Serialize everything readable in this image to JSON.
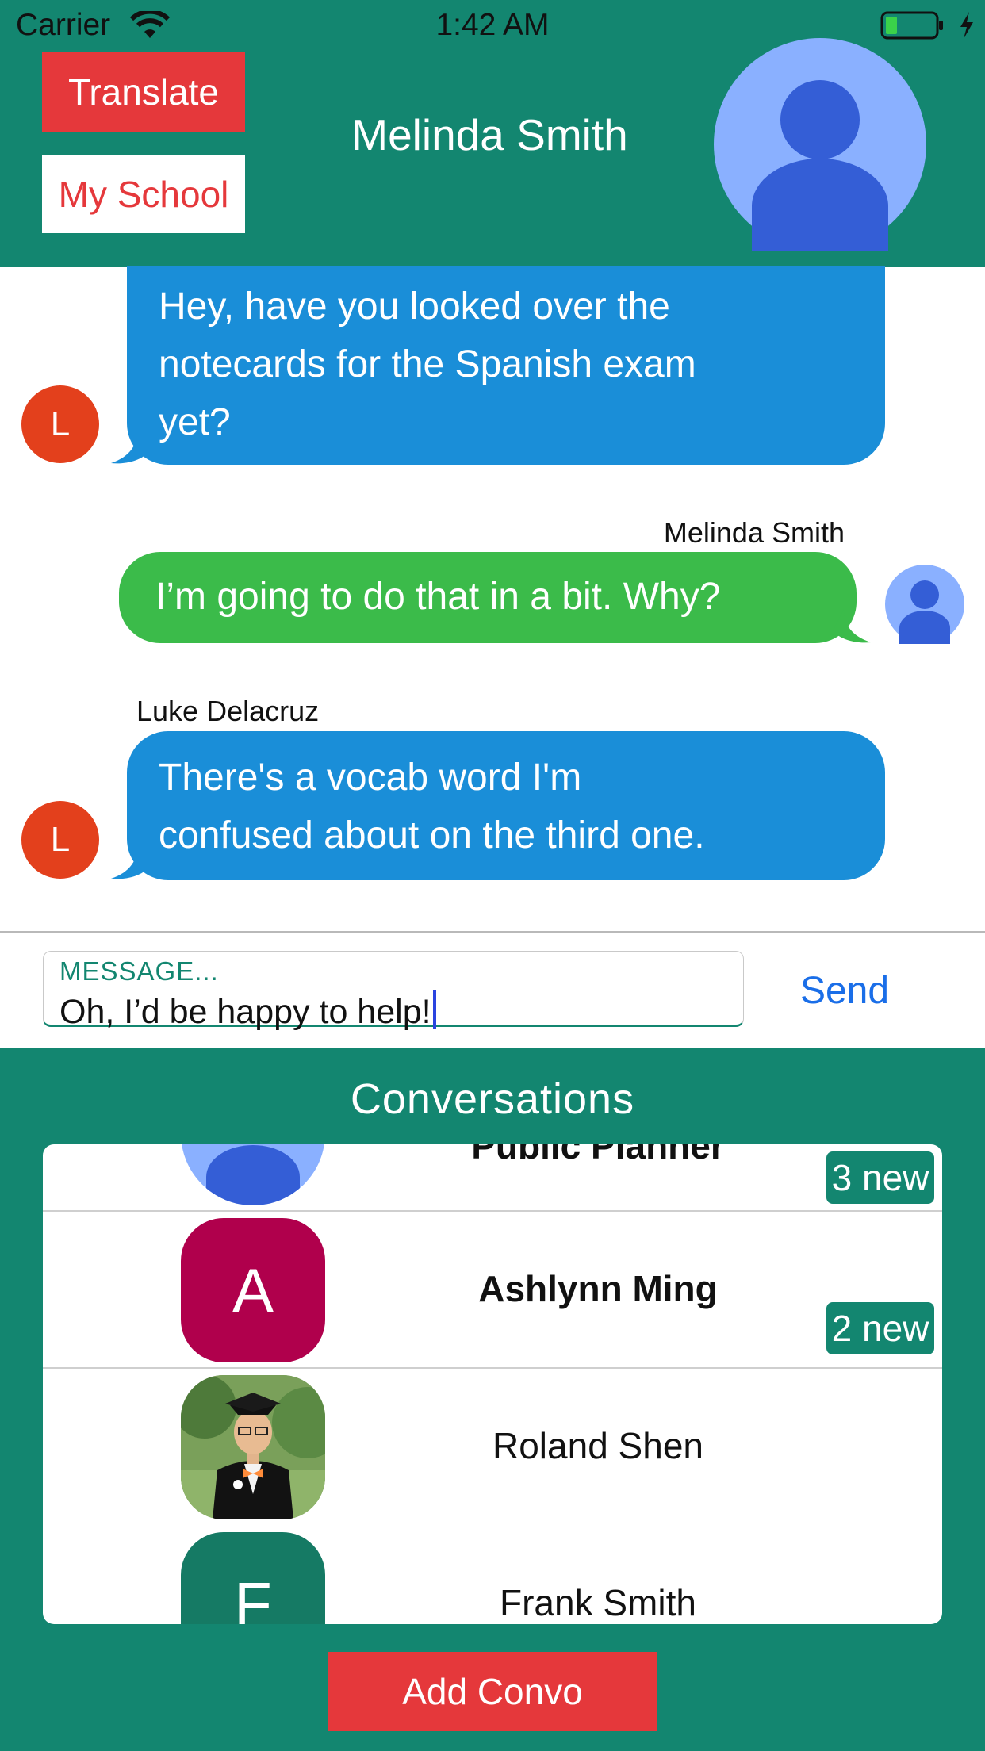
{
  "status_bar": {
    "carrier": "Carrier",
    "time": "1:42 AM"
  },
  "header": {
    "translate_label": "Translate",
    "my_school_label": "My School",
    "contact_name": "Melinda Smith"
  },
  "messages": [
    {
      "sender": "",
      "avatar_letter": "L",
      "direction": "incoming",
      "lines": [
        "Hey, have you looked over the",
        "notecards for the Spanish exam",
        "yet?"
      ]
    },
    {
      "sender": "Melinda Smith",
      "direction": "outgoing",
      "lines": [
        "I’m going to do that in a bit. Why?"
      ]
    },
    {
      "sender": "Luke Delacruz",
      "avatar_letter": "L",
      "direction": "incoming",
      "lines": [
        "There's a vocab word I'm",
        "confused about on the third one."
      ]
    }
  ],
  "composer": {
    "label": "MESSAGE...",
    "value": "Oh, I’d be happy to help!",
    "send_label": "Send"
  },
  "conversations": {
    "title": "Conversations",
    "items": [
      {
        "name": "Public Planner",
        "badge": "3 new",
        "avatar": "person-placeholder"
      },
      {
        "name": "Ashlynn Ming",
        "badge": "2 new",
        "avatar_letter": "A",
        "bold": true
      },
      {
        "name": "Roland Shen",
        "avatar": "photo"
      },
      {
        "name": "Frank Smith",
        "avatar_letter": "F"
      }
    ],
    "add_label": "Add Convo"
  },
  "colors": {
    "brand_teal": "#138670",
    "accent_red": "#e5383b",
    "incoming_bubble": "#1a8ed8",
    "outgoing_bubble": "#3bbb4a",
    "avatar_l": "#e3401c",
    "avatar_a": "#b0004c",
    "link_blue": "#1a6ee8"
  }
}
